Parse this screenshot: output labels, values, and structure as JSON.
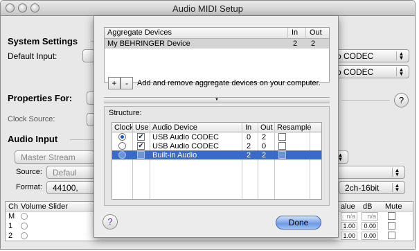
{
  "window": {
    "title": "Audio MIDI Setup"
  },
  "background": {
    "system_settings": "System Settings",
    "default_input_label": "Default Input:",
    "input_popup_value": "o CODEC",
    "output_popup_value": "o CODEC",
    "properties_for": "Properties For:",
    "clock_source": "Clock Source:",
    "audio_input": "Audio Input",
    "master_stream": "Master Stream",
    "source_label": "Source:",
    "source_value": "Defaul",
    "format_label": "Format:",
    "format_value": "44100,",
    "right_format_value": "2ch-16bit",
    "volume_table": {
      "headers": {
        "ch": "Ch",
        "volume_slider": "Volume Slider",
        "value": "alue",
        "db": "dB",
        "mute": "Mute"
      },
      "rows": [
        {
          "ch": "M",
          "value": "n/a",
          "db": "n/a"
        },
        {
          "ch": "1",
          "value": "1.00",
          "db": "0.00"
        },
        {
          "ch": "2",
          "value": "1.00",
          "db": "0.00"
        }
      ]
    }
  },
  "sheet": {
    "aggregate_table": {
      "headers": {
        "name": "Aggregate Devices",
        "in": "In",
        "out": "Out"
      },
      "rows": [
        {
          "name": "My BEHRINGER Device",
          "in": "2",
          "out": "2"
        }
      ]
    },
    "add_button": "+",
    "remove_button": "-",
    "hint_text": "Add and remove aggregate devices on your computer.",
    "structure_label": "Structure:",
    "structure_table": {
      "headers": {
        "clock": "Clock",
        "use": "Use",
        "device": "Audio Device",
        "in": "In",
        "out": "Out",
        "resample": "Resample"
      },
      "rows": [
        {
          "clock": true,
          "use": true,
          "device": "USB Audio CODEC",
          "in": "0",
          "out": "2",
          "resample": false,
          "selected": false
        },
        {
          "clock": false,
          "use": true,
          "device": "USB Audio CODEC",
          "in": "2",
          "out": "0",
          "resample": false,
          "selected": false
        },
        {
          "clock": false,
          "use": false,
          "device": "Built-in Audio",
          "in": "2",
          "out": "2",
          "resample": false,
          "selected": true
        }
      ]
    },
    "help_glyph": "?",
    "done_button": "Done"
  },
  "colors": {
    "selection": "#3a69c8",
    "done_accent": "#6f9ae6",
    "radio_on": "#1c58c2"
  },
  "icons": {
    "help": "question-mark-icon",
    "check": "checkmark-icon",
    "splitter": "drag-handle-icon",
    "popup_arrows": "up-down-arrows-icon"
  }
}
